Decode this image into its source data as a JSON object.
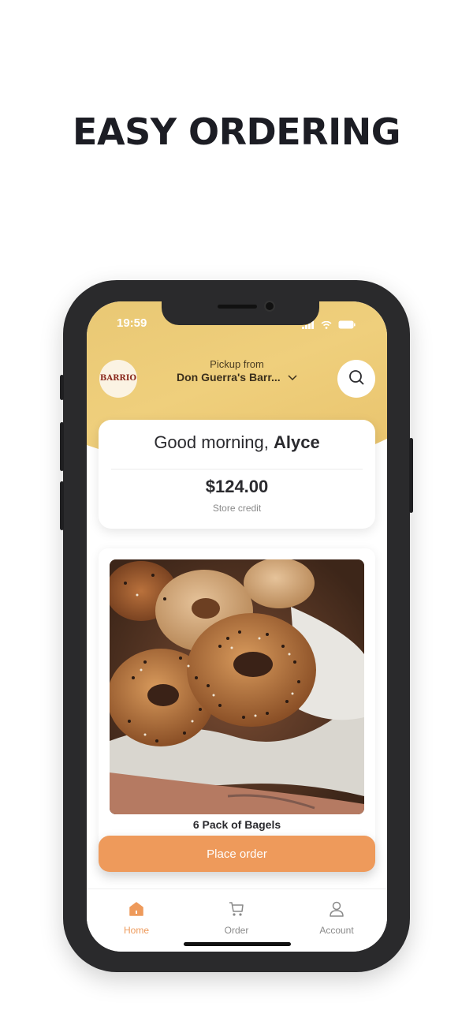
{
  "headline": "EASY ORDERING",
  "status_bar": {
    "time": "19:59"
  },
  "header": {
    "logo_text": "BARRIO",
    "pickup_label": "Pickup from",
    "store_name": "Don Guerra's Barr...",
    "search_icon": "search-icon"
  },
  "greeting": {
    "prefix": "Good morning,",
    "name": "Alyce",
    "credit_amount": "$124.00",
    "credit_label": "Store credit"
  },
  "product": {
    "name": "6 Pack of Bagels"
  },
  "cta": {
    "label": "Place order"
  },
  "tabs": [
    {
      "label": "Home",
      "icon": "home-icon",
      "active": true
    },
    {
      "label": "Order",
      "icon": "cart-icon",
      "active": false
    },
    {
      "label": "Account",
      "icon": "account-icon",
      "active": false
    }
  ],
  "colors": {
    "accent": "#ee9a5b",
    "header": "#efcf7c",
    "text": "#2a2a2e"
  }
}
